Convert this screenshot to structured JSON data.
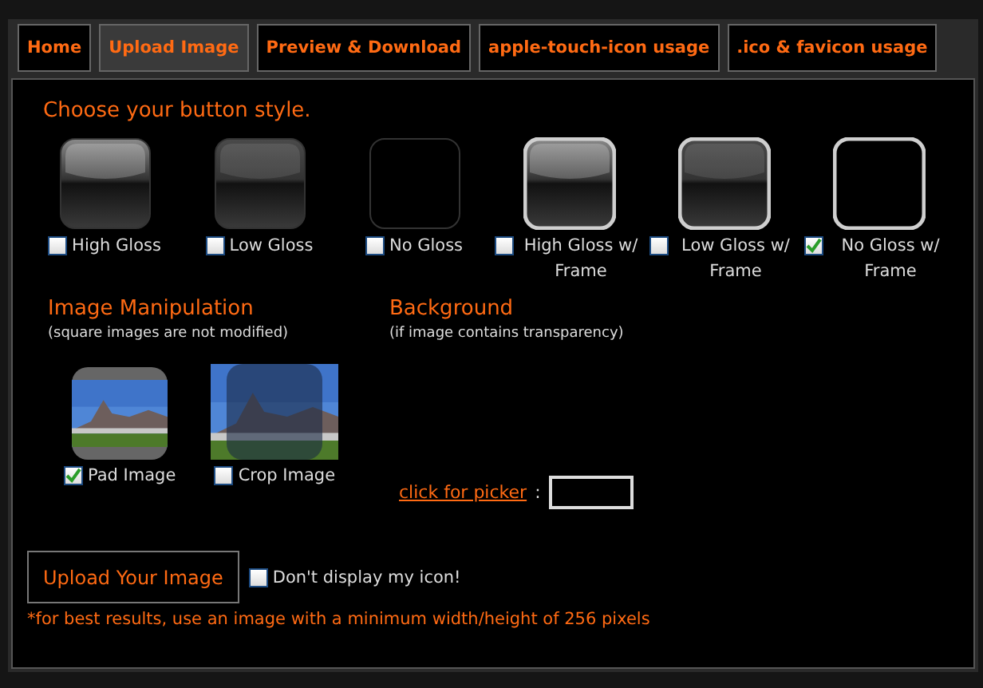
{
  "tabs": [
    {
      "label": "Home",
      "selected": false
    },
    {
      "label": "Upload Image",
      "selected": true
    },
    {
      "label": "Preview & Download",
      "selected": false
    },
    {
      "label": "apple-touch-icon usage",
      "selected": false
    },
    {
      "label": ".ico & favicon usage",
      "selected": false
    }
  ],
  "button_style": {
    "heading": "Choose your button style.",
    "options": [
      {
        "label": "High Gloss",
        "kind": "high",
        "framed": false,
        "checked": false
      },
      {
        "label": "Low Gloss",
        "kind": "low",
        "framed": false,
        "checked": false
      },
      {
        "label": "No Gloss",
        "kind": "none",
        "framed": false,
        "checked": false
      },
      {
        "label": "High Gloss w/ Frame",
        "kind": "high",
        "framed": true,
        "checked": false
      },
      {
        "label": "Low Gloss w/ Frame",
        "kind": "low",
        "framed": true,
        "checked": false
      },
      {
        "label": "No Gloss w/ Frame",
        "kind": "none",
        "framed": true,
        "checked": true
      }
    ]
  },
  "image_manipulation": {
    "heading": "Image Manipulation",
    "note": "(square images are not modified)",
    "options": [
      {
        "label": "Pad Image",
        "kind": "pad",
        "checked": true
      },
      {
        "label": "Crop Image",
        "kind": "crop",
        "checked": false
      }
    ]
  },
  "background": {
    "heading": "Background",
    "note": "(if image contains transparency)",
    "link": "click for picker",
    "separator": ":"
  },
  "upload_button": "Upload Your Image",
  "hide_icon": {
    "label": "Don't display my icon!",
    "checked": false
  },
  "footnote": "*for best results, use an image with a minimum width/height of 256 pixels"
}
